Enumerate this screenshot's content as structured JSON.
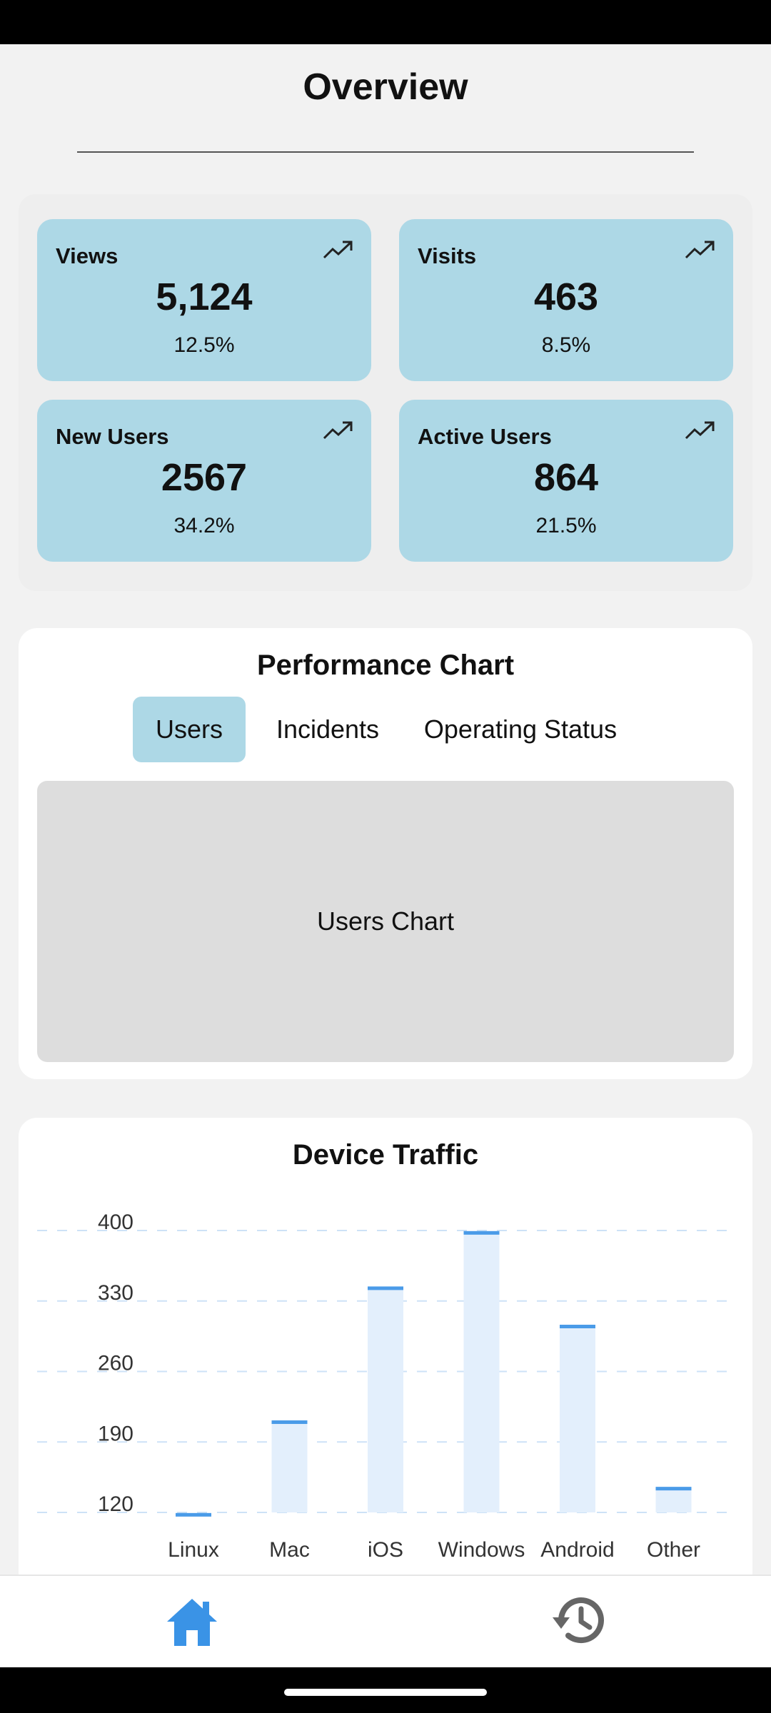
{
  "header": {
    "title": "Overview"
  },
  "stats": [
    {
      "label": "Views",
      "value": "5,124",
      "change": "12.5%",
      "icon": "trending-up-icon"
    },
    {
      "label": "Visits",
      "value": "463",
      "change": "8.5%",
      "icon": "trending-up-icon"
    },
    {
      "label": "New Users",
      "value": "2567",
      "change": "34.2%",
      "icon": "trending-up-icon"
    },
    {
      "label": "Active Users",
      "value": "864",
      "change": "21.5%",
      "icon": "trending-up-icon"
    }
  ],
  "performance": {
    "title": "Performance Chart",
    "tabs": [
      {
        "label": "Users",
        "active": true
      },
      {
        "label": "Incidents",
        "active": false
      },
      {
        "label": "Operating Status",
        "active": false
      }
    ],
    "placeholder": "Users Chart"
  },
  "device_traffic": {
    "title": "Device Traffic"
  },
  "chart_data": {
    "type": "bar",
    "title": "Device Traffic",
    "categories": [
      "Linux",
      "Mac",
      "iOS",
      "Windows",
      "Android",
      "Other"
    ],
    "values": [
      118,
      210,
      343,
      398,
      305,
      144
    ],
    "yticks": [
      120,
      190,
      260,
      330,
      400
    ],
    "ylim": [
      120,
      400
    ],
    "grid": true,
    "bar_fill": "#e3effc",
    "bar_cap": "#4a9be8",
    "grid_color": "#cde2f7"
  },
  "nav": {
    "items": [
      {
        "icon": "home-icon",
        "active": true
      },
      {
        "icon": "history-icon",
        "active": false
      }
    ],
    "active_color": "#3a93e6",
    "inactive_color": "#666666"
  },
  "colors": {
    "card": "#add8e6",
    "background": "#f2f2f2"
  }
}
